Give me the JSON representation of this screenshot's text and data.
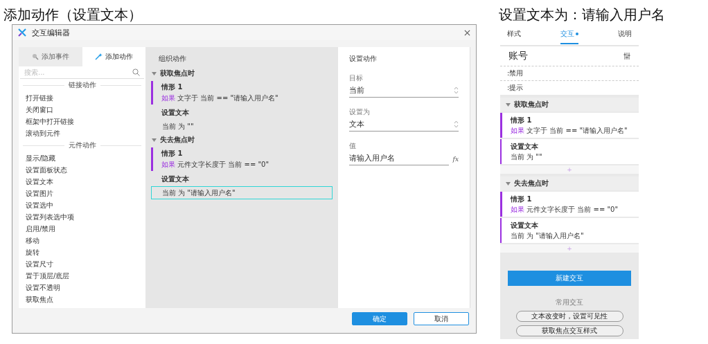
{
  "left_caption": "添加动作（设置文本）",
  "right_caption": "设置文本为：请输入用户名",
  "dialog": {
    "title": "交互编辑器",
    "tabs": [
      {
        "label": "添加事件",
        "selected": false
      },
      {
        "label": "添加动作",
        "selected": true
      }
    ],
    "search": {
      "placeholder": "搜索..."
    },
    "action_groups": [
      {
        "title": "链接动作",
        "items": [
          "打开链接",
          "关闭窗口",
          "框架中打开链接",
          "滚动到元件"
        ]
      },
      {
        "title": "元件动作",
        "items": [
          "显示/隐藏",
          "设置面板状态",
          "设置文本",
          "设置图片",
          "设置选中",
          "设置列表选中项",
          "启用/禁用",
          "移动",
          "旋转",
          "设置尺寸",
          "置于顶层/底层",
          "设置不透明",
          "获取焦点"
        ]
      }
    ],
    "organize": {
      "title": "组织动作",
      "events": [
        {
          "name": "获取焦点时",
          "expanded": true,
          "case": {
            "name": "情形 1",
            "keyword": "如果",
            "condition": "文字于 当前 == \"请输入用户名\""
          },
          "action": {
            "name": "设置文本",
            "detail": "当前 为 \"\"",
            "selected": false
          }
        },
        {
          "name": "失去焦点时",
          "expanded": true,
          "case": {
            "name": "情形 1",
            "keyword": "如果",
            "condition": "元件文字长度于 当前 == \"0\""
          },
          "action": {
            "name": "设置文本",
            "detail": "当前 为 \"请输入用户名\"",
            "selected": true
          }
        }
      ]
    },
    "settings": {
      "title": "设置动作",
      "fields": [
        {
          "kind": "select",
          "label": "目标",
          "value": "当前"
        },
        {
          "kind": "select",
          "label": "设置为",
          "value": "文本"
        },
        {
          "kind": "text",
          "label": "值",
          "value": "请输入用户名",
          "button": "fx"
        }
      ]
    },
    "buttons": [
      {
        "label": "确定",
        "primary": true
      },
      {
        "label": "取消",
        "primary": false
      }
    ]
  },
  "panel": {
    "tabs": [
      {
        "label": "样式",
        "selected": false
      },
      {
        "label": "交互",
        "selected": true
      },
      {
        "label": "说明",
        "selected": false
      }
    ],
    "widget_name": "账号",
    "options": [
      ":禁用",
      ":提示"
    ],
    "events": [
      {
        "name": "获取焦点时",
        "expanded": true,
        "case": {
          "name": "情形 1",
          "keyword": "如果",
          "condition": "文字于 当前 == \"请输入用户名\""
        },
        "action": {
          "name": "设置文本",
          "detail": "当前 为 \"\""
        },
        "add": "+"
      },
      {
        "name": "失去焦点时",
        "expanded": true,
        "case": {
          "name": "情形 1",
          "keyword": "如果",
          "condition": "元件文字长度于 当前 == \"0\""
        },
        "action": {
          "name": "设置文本",
          "detail": "当前 为 \"请输入用户名\""
        },
        "add": "+"
      }
    ],
    "new_button": "新建交互",
    "common_label": "常用交互",
    "common": [
      "文本改变时，设置可见性",
      "获取焦点交互样式"
    ]
  }
}
